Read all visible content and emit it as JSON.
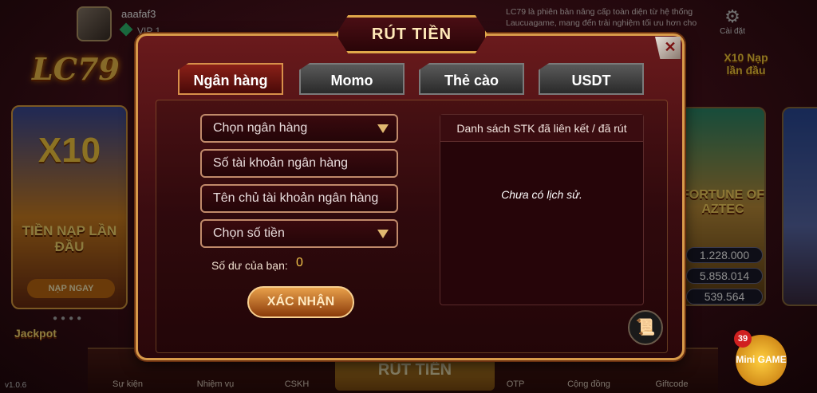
{
  "background": {
    "username": "aaafaf3",
    "vip_label": "VIP 1",
    "notice": "LC79 là phiên bản nâng cấp toàn diện từ hệ thống Laucuagame, mang đến trải nghiệm tối ưu hơn cho",
    "settings_label": "Cài đặt",
    "logo": "LC79",
    "promo": {
      "multiplier": "X10",
      "title": "TIỀN NẠP LẦN ĐẦU",
      "button": "NẠP NGAY"
    },
    "x10_badge": "X10 Nạp lần đầu",
    "game_title": "FORTUNE OF AZTEC",
    "jackpots": [
      "1.228.000",
      "5.858.014",
      "539.564"
    ],
    "jackpot_logo": "Jackpot",
    "version": "v1.0.6",
    "nav": [
      "Sự kiện",
      "Nhiệm vụ",
      "CSKH",
      "OTP",
      "Cộng đồng",
      "Giftcode"
    ],
    "nav_center": "RÚT TIỀN",
    "mini_game_label": "Mini GAME",
    "mini_game_badge": "39"
  },
  "modal": {
    "title": "RÚT TIỀN",
    "close_icon": "close-icon",
    "tabs": [
      {
        "label": "Ngân hàng",
        "active": true
      },
      {
        "label": "Momo",
        "active": false
      },
      {
        "label": "Thẻ cào",
        "active": false
      },
      {
        "label": "USDT",
        "active": false
      }
    ],
    "form": {
      "bank_select": "Chọn ngân hàng",
      "account_number_placeholder": "Số tài khoản ngân hàng",
      "account_name_placeholder": "Tên chủ tài khoản ngân hàng",
      "amount_select": "Chọn số tiền",
      "balance_label": "Số dư của bạn:",
      "balance_value": "0",
      "confirm_button": "XÁC NHẬN"
    },
    "history": {
      "header": "Danh sách STK đã liên kết / đã rút",
      "empty_text": "Chưa có lịch sử."
    },
    "doc_icon": "document-icon"
  }
}
